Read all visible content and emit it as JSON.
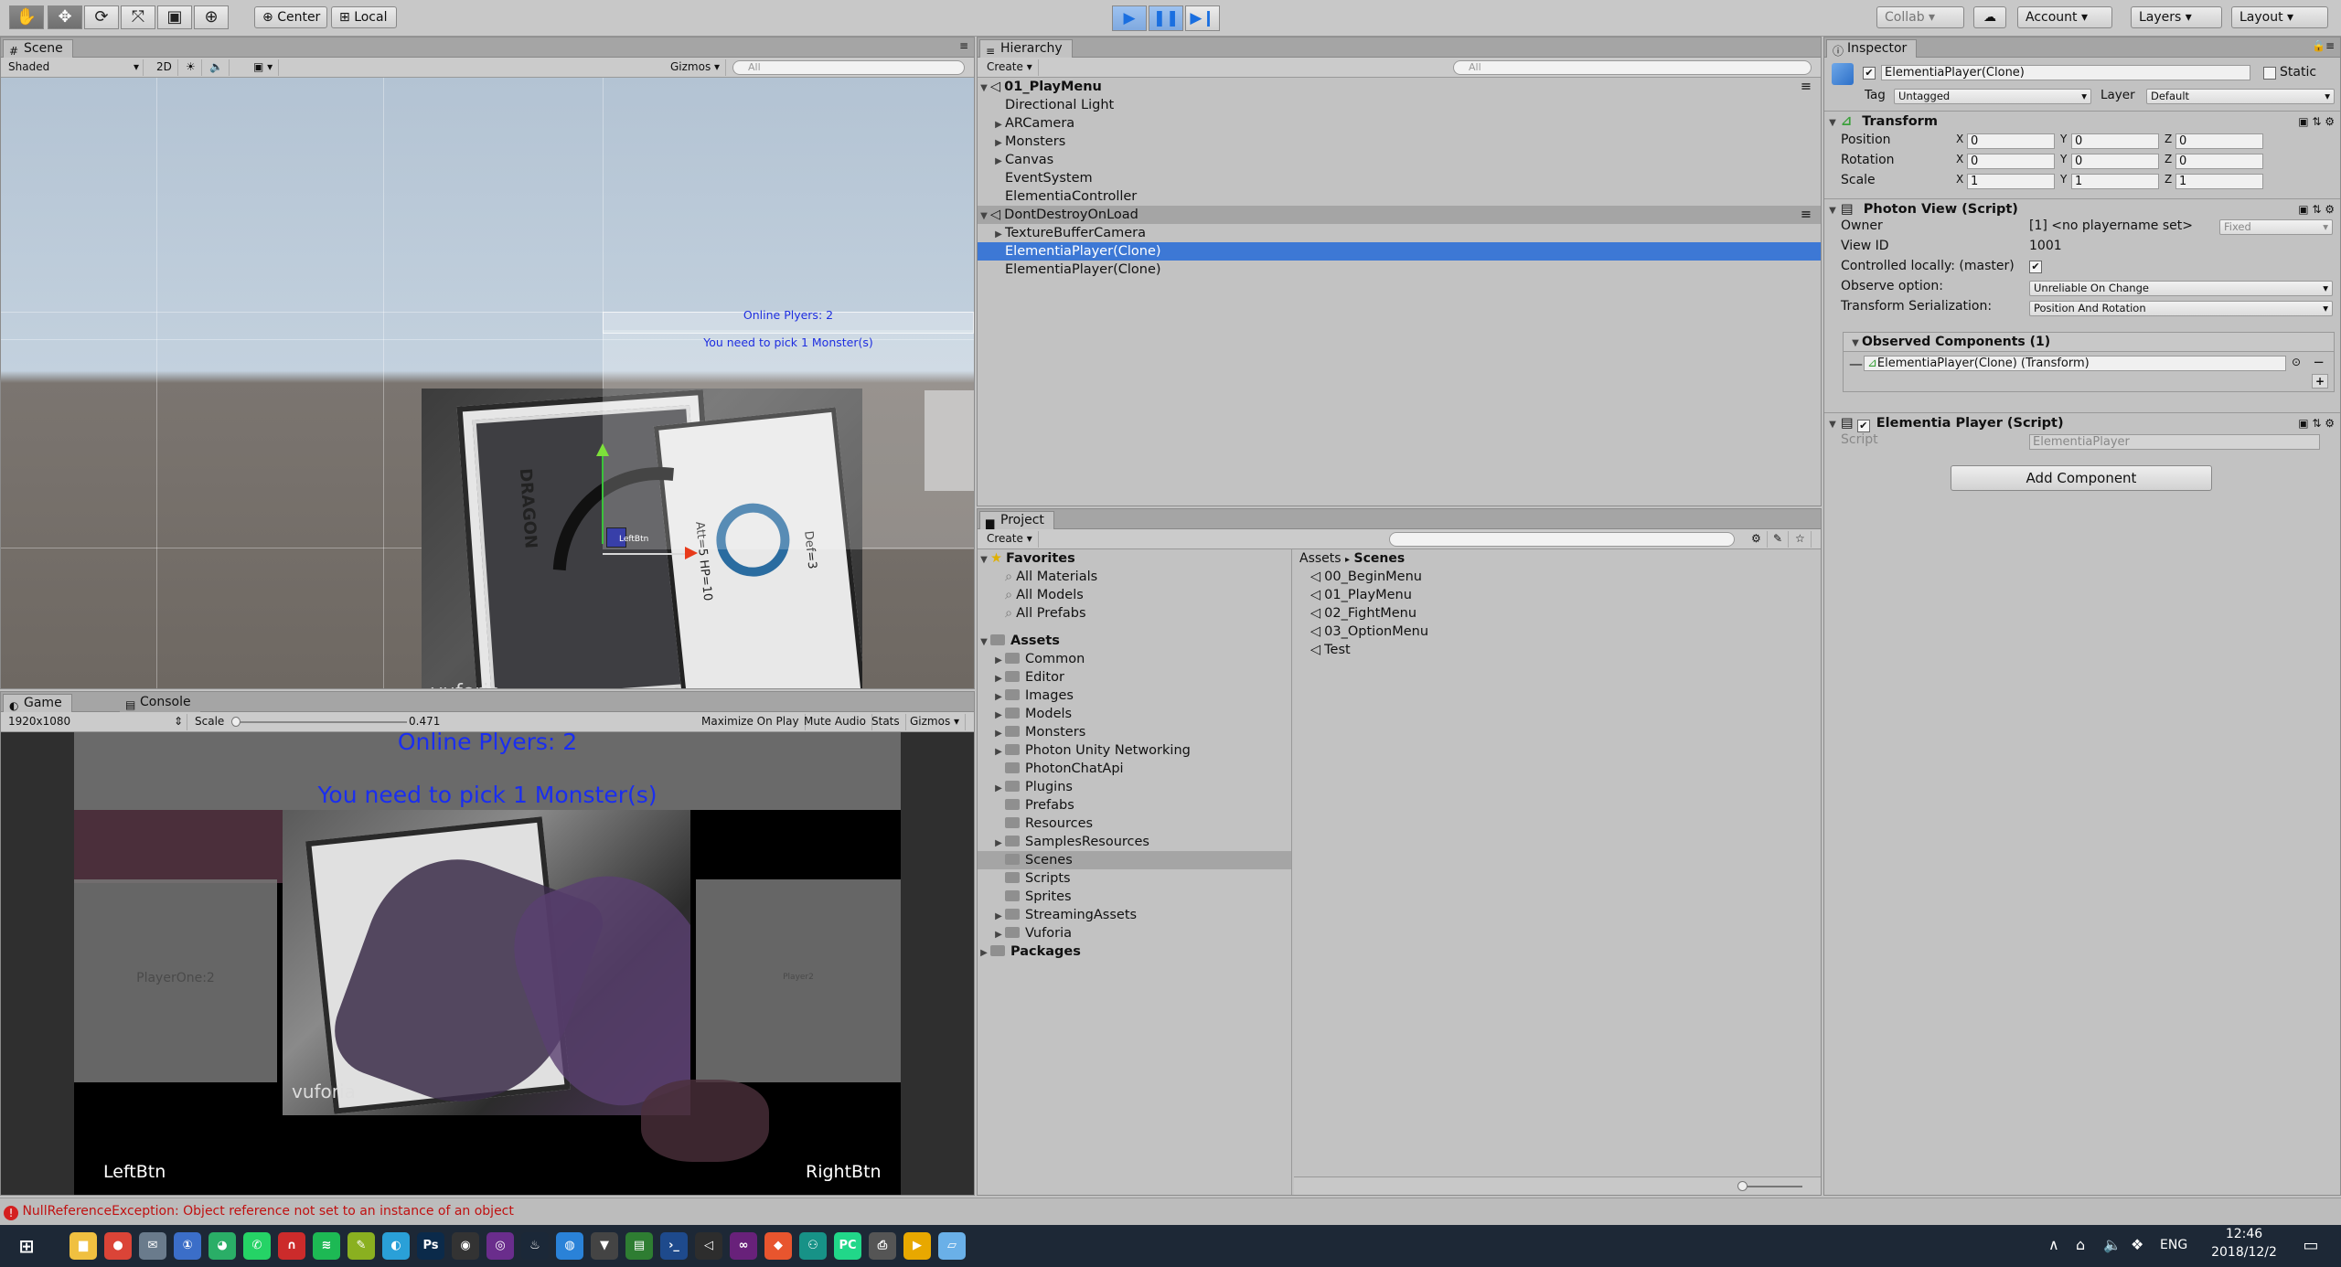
{
  "toolbar": {
    "tools": [
      "✋",
      "✥",
      "⟳",
      "⤧",
      "▣",
      "⊕"
    ],
    "pivot": "Center",
    "space": "Local",
    "collab": "Collab ▾",
    "account": "Account",
    "layers": "Layers",
    "layout": "Layout"
  },
  "scene": {
    "tab": "Scene",
    "shading": "Shaded",
    "mode2d": "2D",
    "gizmos": "Gizmos",
    "search_placeholder": "All",
    "online_players": "Online Plyers: 2",
    "pick_text": "You need to pick 1 Monster(s)",
    "leftbtn": "LeftBtn",
    "vuforia": "vuforia",
    "card_dragon": "DRAGON",
    "card_att": "Att=5  HP=10",
    "card_def": "Def=3"
  },
  "game": {
    "tab": "Game",
    "console_tab": "Console",
    "resolution": "1920x1080",
    "scale_label": "Scale",
    "scale_value": "0.471",
    "maximize": "Maximize On Play",
    "mute": "Mute Audio",
    "stats": "Stats",
    "gizmos": "Gizmos",
    "online_players": "Online Plyers: 2",
    "pick_text": "You need to pick 1 Monster(s)",
    "player_one": "PlayerOne:2",
    "player2": "Player2",
    "left_btn": "LeftBtn",
    "right_btn": "RightBtn",
    "vuforia": "vuforia"
  },
  "hierarchy": {
    "tab": "Hierarchy",
    "create": "Create",
    "search_placeholder": "All",
    "scene1": "01_PlayMenu",
    "items1": [
      {
        "label": "Directional Light",
        "arrow": ""
      },
      {
        "label": "ARCamera",
        "arrow": "▶"
      },
      {
        "label": "Monsters",
        "arrow": "▶"
      },
      {
        "label": "Canvas",
        "arrow": "▶"
      },
      {
        "label": "EventSystem",
        "arrow": ""
      },
      {
        "label": "ElementiaController",
        "arrow": ""
      }
    ],
    "scene2": "DontDestroyOnLoad",
    "items2": [
      {
        "label": "TextureBufferCamera",
        "arrow": "▶"
      },
      {
        "label": "ElementiaPlayer(Clone)",
        "arrow": ""
      },
      {
        "label": "ElementiaPlayer(Clone)",
        "arrow": ""
      }
    ]
  },
  "project": {
    "tab": "Project",
    "create": "Create",
    "favorites": "Favorites",
    "fav_items": [
      "All Materials",
      "All Models",
      "All Prefabs"
    ],
    "assets": "Assets",
    "folders": [
      {
        "label": "Common",
        "arrow": "▶"
      },
      {
        "label": "Editor",
        "arrow": "▶"
      },
      {
        "label": "Images",
        "arrow": "▶"
      },
      {
        "label": "Models",
        "arrow": "▶"
      },
      {
        "label": "Monsters",
        "arrow": "▶"
      },
      {
        "label": "Photon Unity Networking",
        "arrow": "▶"
      },
      {
        "label": "PhotonChatApi",
        "arrow": ""
      },
      {
        "label": "Plugins",
        "arrow": "▶"
      },
      {
        "label": "Prefabs",
        "arrow": ""
      },
      {
        "label": "Resources",
        "arrow": ""
      },
      {
        "label": "SamplesResources",
        "arrow": "▶"
      },
      {
        "label": "Scenes",
        "arrow": ""
      },
      {
        "label": "Scripts",
        "arrow": ""
      },
      {
        "label": "Sprites",
        "arrow": ""
      },
      {
        "label": "StreamingAssets",
        "arrow": "▶"
      },
      {
        "label": "Vuforia",
        "arrow": "▶"
      }
    ],
    "packages": "Packages",
    "breadcrumb_root": "Assets",
    "breadcrumb_current": "Scenes",
    "scenes": [
      "00_BeginMenu",
      "01_PlayMenu",
      "02_FightMenu",
      "03_OptionMenu",
      "Test"
    ]
  },
  "inspector": {
    "tab": "Inspector",
    "object_name": "ElementiaPlayer(Clone)",
    "static": "Static",
    "tag_label": "Tag",
    "tag_value": "Untagged",
    "layer_label": "Layer",
    "layer_value": "Default",
    "transform": {
      "title": "Transform",
      "position": "Position",
      "rotation": "Rotation",
      "scale": "Scale",
      "pos": [
        "0",
        "0",
        "0"
      ],
      "rot": [
        "0",
        "0",
        "0"
      ],
      "scl": [
        "1",
        "1",
        "1"
      ]
    },
    "photon": {
      "title": "Photon View (Script)",
      "owner_label": "Owner",
      "owner_value": "[1] <no playername set>",
      "owner_mode": "Fixed",
      "viewid_label": "View ID",
      "viewid_value": "1001",
      "controlled_label": "Controlled locally: (master)",
      "observe_label": "Observe option:",
      "observe_value": "Unreliable On Change",
      "serialization_label": "Transform Serialization:",
      "serialization_value": "Position And Rotation",
      "observed_title": "Observed Components (1)",
      "observed_item": "ElementiaPlayer(Clone) (Transform)"
    },
    "elementia": {
      "title": "Elementia Player (Script)",
      "script_label": "Script",
      "script_value": "ElementiaPlayer"
    },
    "add_component": "Add Component"
  },
  "status": {
    "message": "NullReferenceException: Object reference not set to an instance of an object"
  },
  "taskbar": {
    "lang": "ENG",
    "time": "12:46",
    "date": "2018/12/2",
    "icons": [
      {
        "name": "explorer-icon",
        "color": "#f0c040",
        "glyph": "▆"
      },
      {
        "name": "chrome-icon",
        "color": "#db4437",
        "glyph": "●"
      },
      {
        "name": "mail-icon",
        "color": "#6a7b8c",
        "glyph": "✉"
      },
      {
        "name": "1password-icon",
        "color": "#3b6ec8",
        "glyph": "①"
      },
      {
        "name": "wechat-icon",
        "color": "#2aae67",
        "glyph": "◕"
      },
      {
        "name": "whatsapp-icon",
        "color": "#25d366",
        "glyph": "✆"
      },
      {
        "name": "authy-icon",
        "color": "#cc2b2b",
        "glyph": "∩"
      },
      {
        "name": "spotify-icon",
        "color": "#1db954",
        "glyph": "≋"
      },
      {
        "name": "pen-icon",
        "color": "#8ab020",
        "glyph": "✎"
      },
      {
        "name": "globe-icon",
        "color": "#2aa0d8",
        "glyph": "◐"
      },
      {
        "name": "photoshop-icon",
        "color": "#0b2a4a",
        "glyph": "Ps"
      },
      {
        "name": "obs-icon",
        "color": "#333333",
        "glyph": "◉"
      },
      {
        "name": "aura-icon",
        "color": "#6a2d8c",
        "glyph": "◎"
      },
      {
        "name": "steam-icon",
        "color": "#1b2838",
        "glyph": "♨"
      },
      {
        "name": "uplay-icon",
        "color": "#2a82d8",
        "glyph": "◍"
      },
      {
        "name": "fox-icon",
        "color": "#444444",
        "glyph": "▼"
      },
      {
        "name": "sheet-icon",
        "color": "#2e7d32",
        "glyph": "▤"
      },
      {
        "name": "powershell-icon",
        "color": "#1e4a8c",
        "glyph": "›_"
      },
      {
        "name": "unity-icon",
        "color": "#2d2d2d",
        "glyph": "◁"
      },
      {
        "name": "visual-studio-icon",
        "color": "#68217a",
        "glyph": "∞"
      },
      {
        "name": "git-icon",
        "color": "#e8552e",
        "glyph": "◆"
      },
      {
        "name": "gitkraken-icon",
        "color": "#179287",
        "glyph": "⚇"
      },
      {
        "name": "pycharm-icon",
        "color": "#21d789",
        "glyph": "PC"
      },
      {
        "name": "printer-icon",
        "color": "#555555",
        "glyph": "⎙"
      },
      {
        "name": "media-player-icon",
        "color": "#e8a800",
        "glyph": "▶"
      },
      {
        "name": "notes-icon",
        "color": "#6ab0e8",
        "glyph": "▱"
      }
    ]
  }
}
